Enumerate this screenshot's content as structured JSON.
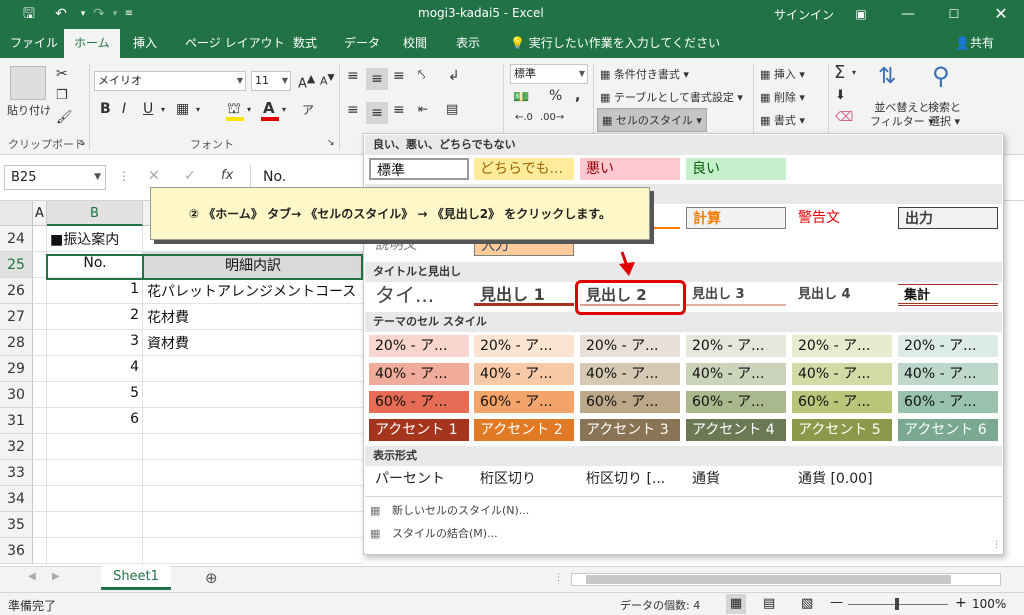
{
  "titlebar": {
    "filename": "mogi3-kadai5",
    "separator": " - ",
    "app": "Excel",
    "signin": "サインイン"
  },
  "tabs": [
    "ファイル",
    "ホーム",
    "挿入",
    "ページ レイアウト",
    "数式",
    "データ",
    "校閲",
    "表示"
  ],
  "tellme": "実行したい作業を入力してください",
  "share": "共有",
  "ribbon": {
    "paste": "貼り付け",
    "clipboard_label": "クリップボード",
    "font_name": "メイリオ",
    "font_size": "11",
    "font_label": "フォント",
    "bold": "B",
    "italic": "I",
    "underline": "U",
    "number_format": "標準",
    "percent": "%",
    "comma": ",",
    "cond_format": "条件付き書式",
    "table_format": "テーブルとして書式設定",
    "cell_styles": "セルのスタイル",
    "insert": "挿入",
    "delete": "削除",
    "format": "書式",
    "sort_filter_1": "並べ替えと",
    "sort_filter_2": "フィルター",
    "find_select_1": "検索と",
    "find_select_2": "選択",
    "sigma": "Σ"
  },
  "formula": {
    "namebox": "B25",
    "fx": "fx",
    "value": "No."
  },
  "grid": {
    "col_a": "A",
    "col_b": "B",
    "rows": [
      {
        "num": "24",
        "b": "■振込案内",
        "c": ""
      },
      {
        "num": "25",
        "b": "No.",
        "c": "明細内訳"
      },
      {
        "num": "26",
        "b": "1",
        "c": "花パレットアレンジメントコース"
      },
      {
        "num": "27",
        "b": "2",
        "c": "花材費"
      },
      {
        "num": "28",
        "b": "3",
        "c": "資材費"
      },
      {
        "num": "29",
        "b": "4",
        "c": ""
      },
      {
        "num": "30",
        "b": "5",
        "c": ""
      },
      {
        "num": "31",
        "b": "6",
        "c": ""
      },
      {
        "num": "32",
        "b": "",
        "c": ""
      },
      {
        "num": "33",
        "b": "",
        "c": ""
      },
      {
        "num": "34",
        "b": "",
        "c": ""
      },
      {
        "num": "35",
        "b": "",
        "c": ""
      },
      {
        "num": "36",
        "b": "",
        "c": ""
      }
    ]
  },
  "sheet_tab": "Sheet1",
  "status": {
    "ready": "準備完了",
    "count": "データの個数: 4",
    "zoom": "100%"
  },
  "callout": "② 《ホーム》 タブ→ 《セルのスタイル》 → 《見出し2》 をクリックします。",
  "gallery": {
    "sec_good_bad": "良い、悪い、どちらでもない",
    "good_bad": [
      "標準",
      "どちらでも...",
      "悪い",
      "良い"
    ],
    "data_model": [
      "ル",
      "計算",
      "警告文",
      "出力"
    ],
    "data_model_2": [
      "説明文",
      "入力"
    ],
    "sec_titles": "タイトルと見出し",
    "titles": [
      "タイ...",
      "見出し 1",
      "見出し 2",
      "見出し 3",
      "見出し 4",
      "集計"
    ],
    "sec_theme": "テーマのセル スタイル",
    "theme_20": [
      "20% - ア...",
      "20% - ア...",
      "20% - ア...",
      "20% - ア...",
      "20% - ア...",
      "20% - ア..."
    ],
    "theme_40": [
      "40% - ア...",
      "40% - ア...",
      "40% - ア...",
      "40% - ア...",
      "40% - ア...",
      "40% - ア..."
    ],
    "theme_60": [
      "60% - ア...",
      "60% - ア...",
      "60% - ア...",
      "60% - ア...",
      "60% - ア...",
      "60% - ア..."
    ],
    "accent": [
      "アクセント 1",
      "アクセント 2",
      "アクセント 3",
      "アクセント 4",
      "アクセント 5",
      "アクセント 6"
    ],
    "sec_number": "表示形式",
    "number": [
      "パーセント",
      "桁区切り",
      "桁区切り [...",
      "通貨",
      "通貨 [0.00]"
    ],
    "new_style": "新しいセルのスタイル(N)...",
    "merge_style": "スタイルの結合(M)..."
  },
  "colors": {
    "excel_green": "#217346",
    "highlight_red": "#e00000",
    "callout_bg": "#fef8c8",
    "accent_colors": [
      "#a5361d",
      "#e07a25",
      "#8b7355",
      "#6b7a55",
      "#8a9a4a",
      "#7aa890"
    ]
  }
}
